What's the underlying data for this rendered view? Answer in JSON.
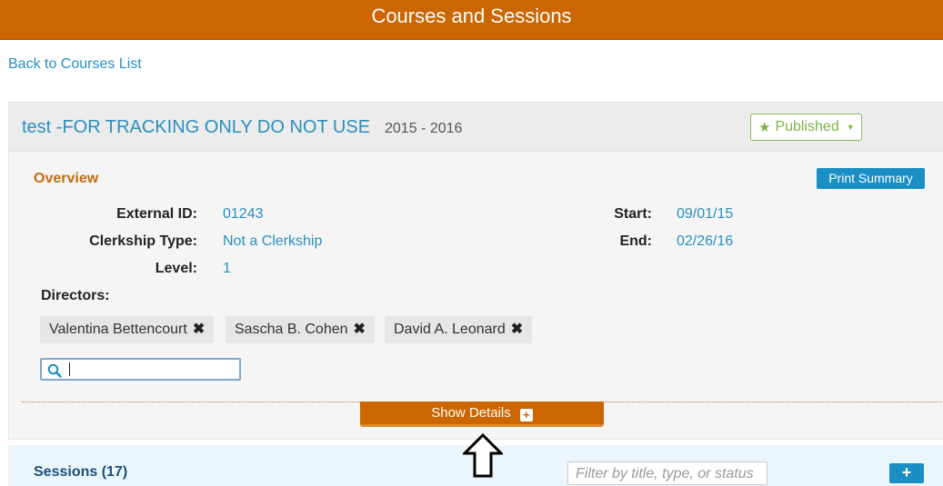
{
  "header": {
    "title": "Courses and Sessions"
  },
  "nav": {
    "back_link": "Back to Courses List"
  },
  "course": {
    "title": "test -FOR TRACKING ONLY DO NOT USE",
    "year": "2015 - 2016",
    "status": {
      "label": "Published",
      "icon": "star-icon"
    }
  },
  "overview": {
    "title": "Overview",
    "print_label": "Print Summary",
    "fields": {
      "external_id": {
        "label": "External ID:",
        "value": "01243"
      },
      "clerkship_type": {
        "label": "Clerkship Type:",
        "value": "Not a Clerkship"
      },
      "level": {
        "label": "Level:",
        "value": "1"
      },
      "start": {
        "label": "Start:",
        "value": "09/01/15"
      },
      "end": {
        "label": "End:",
        "value": "02/26/16"
      }
    },
    "directors_label": "Directors:",
    "directors": [
      "Valentina Bettencourt",
      "Sascha B. Cohen",
      "David A. Leonard"
    ],
    "director_search": {
      "value": "",
      "icon": "search-icon"
    },
    "show_details_label": "Show Details"
  },
  "sessions": {
    "title": "Sessions (17)",
    "filter_placeholder": "Filter by title, type, or status",
    "add_icon": "plus-icon"
  },
  "colors": {
    "header_bg": "#cc6600",
    "link": "#2a8fc1",
    "published": "#7ab547",
    "overview_title": "#c76a10",
    "button_blue": "#1a8fc3"
  }
}
